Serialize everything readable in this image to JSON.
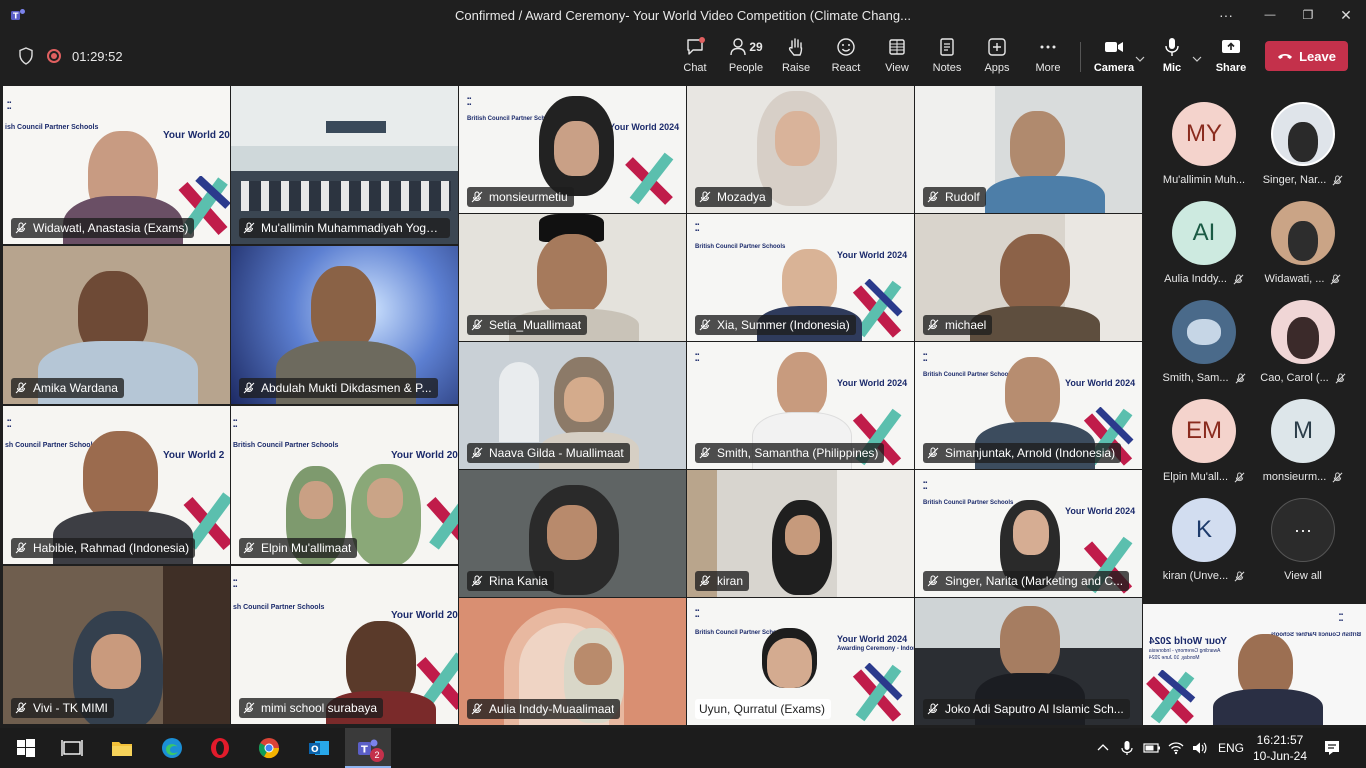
{
  "window": {
    "title": "Confirmed / Award Ceremony- Your World Video Competition (Climate Chang...",
    "more": "···",
    "minimize": "—",
    "maximize": "❐",
    "close": "✕"
  },
  "meeting": {
    "timer": "01:29:52",
    "toolbar": {
      "chat": "Chat",
      "people": "People",
      "people_count": "29",
      "raise": "Raise",
      "react": "React",
      "view": "View",
      "notes": "Notes",
      "apps": "Apps",
      "more": "More",
      "camera": "Camera",
      "mic": "Mic",
      "share": "Share",
      "leave": "Leave"
    }
  },
  "banner": {
    "brand": "BRITISH COUNCIL",
    "partner": "British Council Partner Schools",
    "heading": "Your World 2024",
    "sub": "Awarding Ceremony - Indonesia",
    "date": "Monday, 10 June 2024"
  },
  "tiles": [
    {
      "name": "Widawati, Anastasia (Exams)"
    },
    {
      "name": "Mu'allimin Muhammadiyah Yogya..."
    },
    {
      "name": "monsieurmetiu"
    },
    {
      "name": "Mozadya"
    },
    {
      "name": "Rudolf"
    },
    {
      "name": "Amika Wardana"
    },
    {
      "name": "Abdulah Mukti Dikdasmen & P..."
    },
    {
      "name": "Setia_Muallimaat"
    },
    {
      "name": "Xia, Summer (Indonesia)"
    },
    {
      "name": "michael"
    },
    {
      "name": "Habibie, Rahmad (Indonesia)"
    },
    {
      "name": "Elpin Mu'allimaat"
    },
    {
      "name": "Naava Gilda - Muallimaat"
    },
    {
      "name": "Smith, Samantha (Philippines)"
    },
    {
      "name": "Simanjuntak, Arnold (Indonesia)"
    },
    {
      "name": "Rina Kania"
    },
    {
      "name": "kiran"
    },
    {
      "name": "Singer, Narita (Marketing and C..."
    },
    {
      "name": "Vivi - TK MIMI"
    },
    {
      "name": "mimi school surabaya"
    },
    {
      "name": "Aulia Inddy-Muaalimaat"
    },
    {
      "name": "Uyun, Qurratul (Exams)"
    },
    {
      "name": "Joko Adi Saputro Al Islamic Sch..."
    }
  ],
  "roster": [
    {
      "initials": "MY",
      "name": "Mu'allimin Muh...",
      "color": "#f4d3cc",
      "text": "#8a2b1e"
    },
    {
      "initials": "",
      "name": "Singer, Nar...",
      "color": "#dfe4ea",
      "text": "#333"
    },
    {
      "initials": "AI",
      "name": "Aulia Inddy...",
      "color": "#cdeae0",
      "text": "#1a5a44"
    },
    {
      "initials": "",
      "name": "Widawati, ...",
      "color": "#caa486",
      "text": "#333"
    },
    {
      "initials": "",
      "name": "Smith, Sam...",
      "color": "#4a6a8a",
      "text": "#fff"
    },
    {
      "initials": "",
      "name": "Cao, Carol (...",
      "color": "#f0d6d6",
      "text": "#333"
    },
    {
      "initials": "EM",
      "name": "Elpin Mu'all...",
      "color": "#f4d3cc",
      "text": "#8a2b1e"
    },
    {
      "initials": "M",
      "name": "monsieurm...",
      "color": "#dde6ea",
      "text": "#2c3e4a"
    },
    {
      "initials": "K",
      "name": "kiran (Unve...",
      "color": "#d2ddf0",
      "text": "#1d3a6b"
    },
    {
      "initials": "···",
      "name": "View all",
      "color": "#2b2b2b",
      "text": "#fff"
    }
  ],
  "taskbar": {
    "lang": "ENG",
    "time": "16:21:57",
    "date": "10-Jun-24",
    "teams_badge": "2"
  }
}
